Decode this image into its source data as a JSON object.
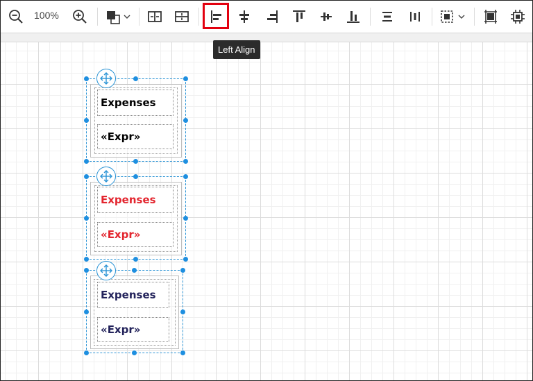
{
  "toolbar": {
    "zoom_level": "100%",
    "tooltip": "Left Align",
    "buttons": [
      "zoom-out-icon",
      "zoom-in-icon",
      "fill-color-icon",
      "distribute-horizontal-icon",
      "distribute-vertical-icon",
      "align-left-icon",
      "align-center-icon",
      "align-right-icon",
      "align-top-icon",
      "align-middle-icon",
      "align-bottom-icon",
      "same-width-icon",
      "same-height-icon",
      "group-select-icon",
      "fit-width-icon",
      "fit-page-icon"
    ]
  },
  "colors": {
    "selection": "#2a93d5",
    "highlight": "#e3000f",
    "text_black": "#000000",
    "text_red": "#e3262f",
    "text_navy": "#23235b"
  },
  "groups": [
    {
      "label": "Expenses",
      "expr": "«Expr»",
      "color": "#000000"
    },
    {
      "label": "Expenses",
      "expr": "«Expr»",
      "color": "#e3262f"
    },
    {
      "label": "Expenses",
      "expr": "«Expr»",
      "color": "#23235b"
    }
  ]
}
